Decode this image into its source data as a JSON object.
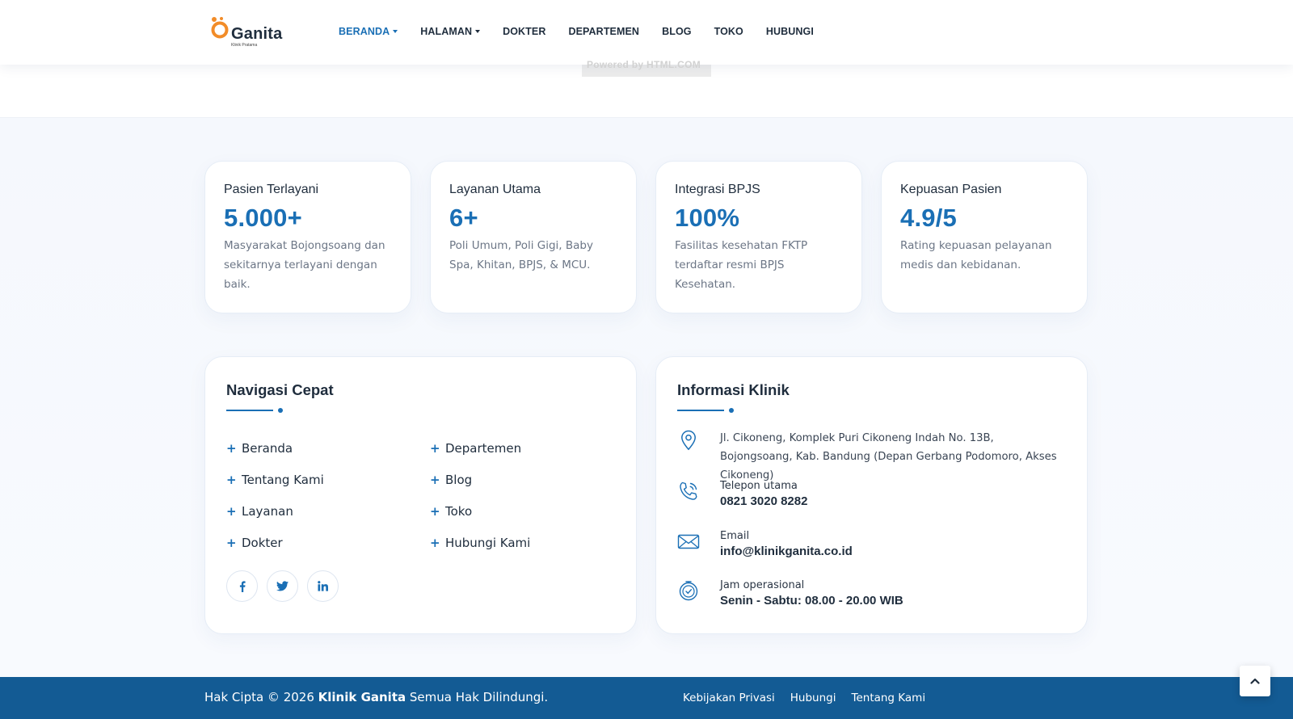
{
  "brand": {
    "name": "Ganita",
    "tagline": "Klinik Pratama"
  },
  "nav": {
    "items": [
      {
        "label": "BERANDA",
        "active": true,
        "dropdown": true
      },
      {
        "label": "HALAMAN",
        "active": false,
        "dropdown": true
      },
      {
        "label": "DOKTER",
        "active": false,
        "dropdown": false
      },
      {
        "label": "DEPARTEMEN",
        "active": false,
        "dropdown": false
      },
      {
        "label": "BLOG",
        "active": false,
        "dropdown": false
      },
      {
        "label": "TOKO",
        "active": false,
        "dropdown": false
      },
      {
        "label": "HUBUNGI",
        "active": false,
        "dropdown": false
      }
    ]
  },
  "powered_by": "Powered by HTML.COM",
  "stats": [
    {
      "title": "Pasien Terlayani",
      "value": "5.000+",
      "desc": "Masyarakat Bojongsoang dan sekitarnya terlayani dengan baik."
    },
    {
      "title": "Layanan Utama",
      "value": "6+",
      "desc": "Poli Umum, Poli Gigi, Baby Spa, Khitan, BPJS, & MCU."
    },
    {
      "title": "Integrasi BPJS",
      "value": "100%",
      "desc": "Fasilitas kesehatan FKTP terdaftar resmi BPJS Kesehatan."
    },
    {
      "title": "Kepuasan Pasien",
      "value": "4.9/5",
      "desc": "Rating kepuasan pelayanan medis dan kebidanan."
    }
  ],
  "quick_nav": {
    "title": "Navigasi Cepat",
    "col1": [
      "Beranda",
      "Tentang Kami",
      "Layanan",
      "Dokter"
    ],
    "col2": [
      "Departemen",
      "Blog",
      "Toko",
      "Hubungi Kami"
    ],
    "social": [
      "facebook-icon",
      "twitter-icon",
      "linkedin-icon"
    ]
  },
  "clinic_info": {
    "title": "Informasi Klinik",
    "address": "Jl. Cikoneng, Komplek Puri Cikoneng Indah No. 13B, Bojongsoang, Kab. Bandung (Depan Gerbang Podomoro, Akses Cikoneng)",
    "phone_label": "Telepon utama",
    "phone": "0821 3020 8282",
    "email_label": "Email",
    "email": "info@klinikganita.co.id",
    "hours_label": "Jam operasional",
    "hours": "Senin - Sabtu: 08.00 - 20.00 WIB"
  },
  "footer": {
    "copyright_prefix": "Hak Cipta © 2026 ",
    "copyright_brand": "Klinik Ganita",
    "copyright_suffix": " Semua Hak Dilindungi.",
    "links": [
      "Kebijakan Privasi",
      "Hubungi",
      "Tentang Kami"
    ]
  },
  "colors": {
    "primary": "#1a6fb5",
    "footer": "#135b94",
    "logo_orange": "#f28c28"
  }
}
